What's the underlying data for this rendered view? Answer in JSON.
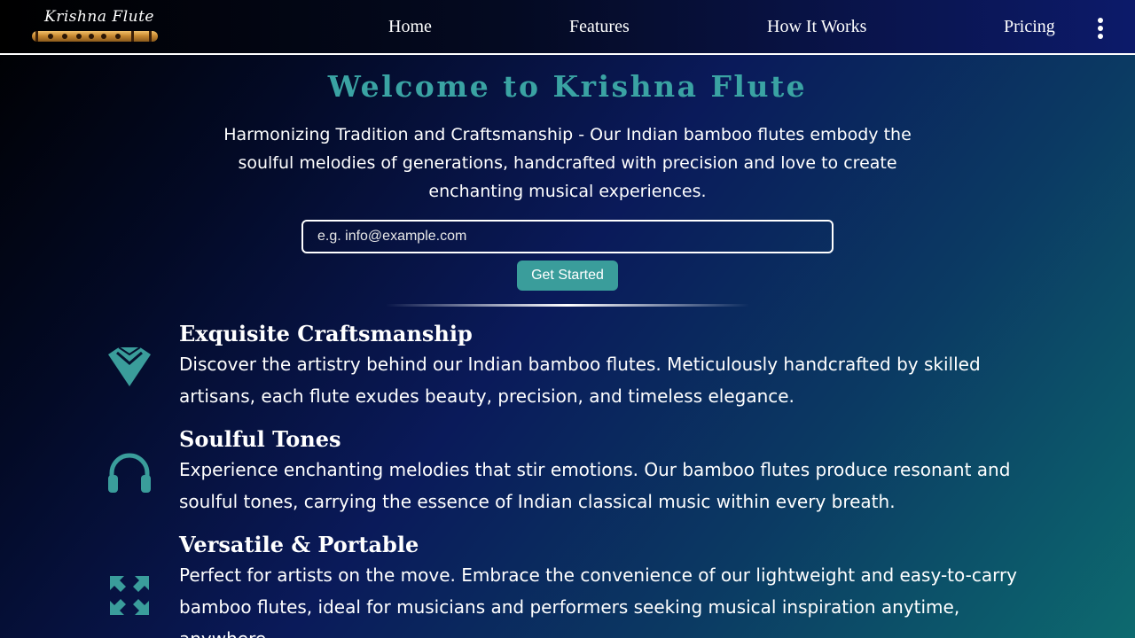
{
  "header": {
    "logo_text": "Krishna Flute",
    "nav": [
      "Home",
      "Features",
      "How It Works",
      "Pricing"
    ],
    "menu_icon": "more-vertical-icon"
  },
  "hero": {
    "title": "Welcome to Krishna Flute",
    "subtitle": "Harmonizing Tradition and Craftsmanship - Our Indian bamboo flutes embody the soulful melodies of generations, handcrafted with precision and love to create enchanting musical experiences.",
    "email_placeholder": "e.g. info@example.com",
    "cta_label": "Get Started"
  },
  "features": [
    {
      "icon": "gem-icon",
      "title": "Exquisite Craftsmanship",
      "description": "Discover the artistry behind our Indian bamboo flutes. Meticulously handcrafted by skilled artisans, each flute exudes beauty, precision, and timeless elegance."
    },
    {
      "icon": "headphones-icon",
      "title": "Soulful Tones",
      "description": "Experience enchanting melodies that stir emotions. Our bamboo flutes produce resonant and soulful tones, carrying the essence of Indian classical music within every breath."
    },
    {
      "icon": "expand-arrows-icon",
      "title": "Versatile & Portable",
      "description": "Perfect for artists on the move. Embrace the convenience of our lightweight and easy-to-carry bamboo flutes, ideal for musicians and performers seeking musical inspiration anytime, anywhere."
    }
  ],
  "colors": {
    "accent": "#3a9d9b",
    "title_teal": "#3aa3a3",
    "text": "#ffffff"
  }
}
